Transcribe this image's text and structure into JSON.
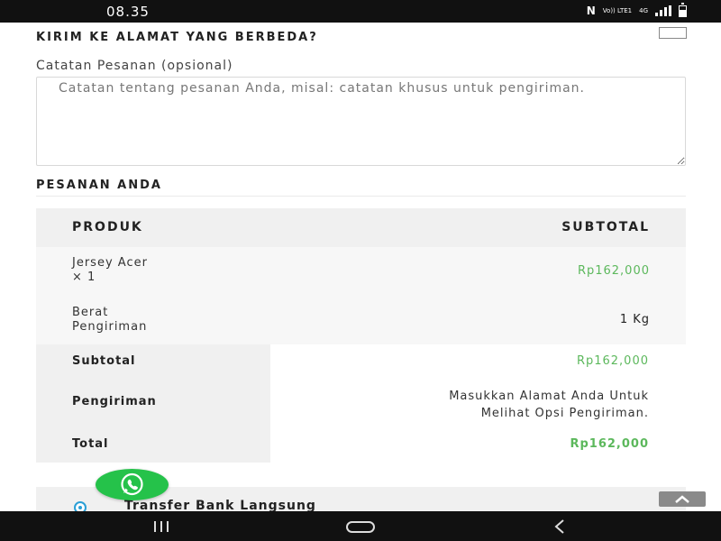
{
  "status_bar": {
    "time": "08.35",
    "network_label": "Vo)) LTE1",
    "network_type": "4G"
  },
  "shipping": {
    "ship_different_label": "KIRIM KE ALAMAT YANG BERBEDA?",
    "checkbox_checked": false
  },
  "notes": {
    "label": "Catatan Pesanan (opsional)",
    "placeholder": "Catatan tentang pesanan Anda, misal: catatan khusus untuk pengiriman.",
    "value": ""
  },
  "order": {
    "title": "PESANAN ANDA",
    "columns": [
      "PRODUK",
      "SUBTOTAL"
    ],
    "items": [
      {
        "name": "Jersey Acer",
        "qty": "× 1",
        "price": "Rp162,000"
      }
    ],
    "weight": {
      "label_line1": "Berat",
      "label_line2": "Pengiriman",
      "value": "1 Kg"
    },
    "subtotal": {
      "label": "Subtotal",
      "value": "Rp162,000"
    },
    "shipping": {
      "label": "Pengiriman",
      "message_line1": "Masukkan Alamat Anda Untuk",
      "message_line2": "Melihat Opsi Pengiriman."
    },
    "total": {
      "label": "Total",
      "value": "Rp162,000"
    }
  },
  "payment": {
    "selected_method": "Transfer Bank Langsung"
  },
  "icons": {
    "whatsapp": "whatsapp-icon",
    "scroll_top": "chevron-up-icon",
    "nav": [
      "recents-icon",
      "home-icon",
      "back-icon"
    ]
  },
  "colors": {
    "price_green": "#5cb85c",
    "whatsapp_green": "#25c24a",
    "radio_blue": "#2a9fd6",
    "status_bar": "#111111"
  }
}
